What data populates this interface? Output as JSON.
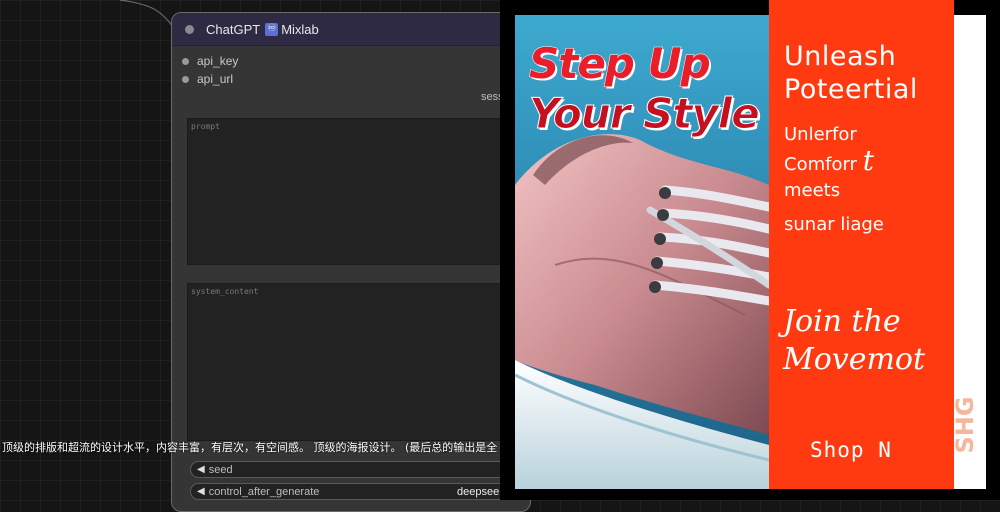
{
  "node": {
    "title": "ChatGPT",
    "badge": "♾",
    "subtitle": "Mixlab",
    "inputs": [
      "api_key",
      "api_url"
    ],
    "session_label": "sess",
    "prompt_placeholder": "prompt",
    "system_placeholder": "system_content",
    "widgets": [
      {
        "label": "seed",
        "value": ""
      },
      {
        "label": "control_after_generate",
        "value": "deepseek"
      }
    ]
  },
  "overlay_text": "顶级的排版和超流的设计水平，内容丰富，有层次，有空间感。 顶级的海报设计。 (最后总的输出是全",
  "poster": {
    "headline_line1": "Step Up",
    "headline_line2": "Your Style",
    "unleash_line1": "Unleash",
    "unleash_line2": "Poteertial",
    "tagline_line1": "Unlerfor",
    "tagline_line2": "Comforr",
    "tagline_glyph": "t",
    "tagline_line3": "meets",
    "tagline_line4": "sunar liage",
    "join_line1": "Join the",
    "join_line2": "Movemot",
    "shop": "Shop N",
    "vertical_mark": "SHG",
    "colors": {
      "accent_red": "#ff3a10",
      "headline_red": "#ea1d2a",
      "sky_blue": "#3ea9cf"
    }
  }
}
